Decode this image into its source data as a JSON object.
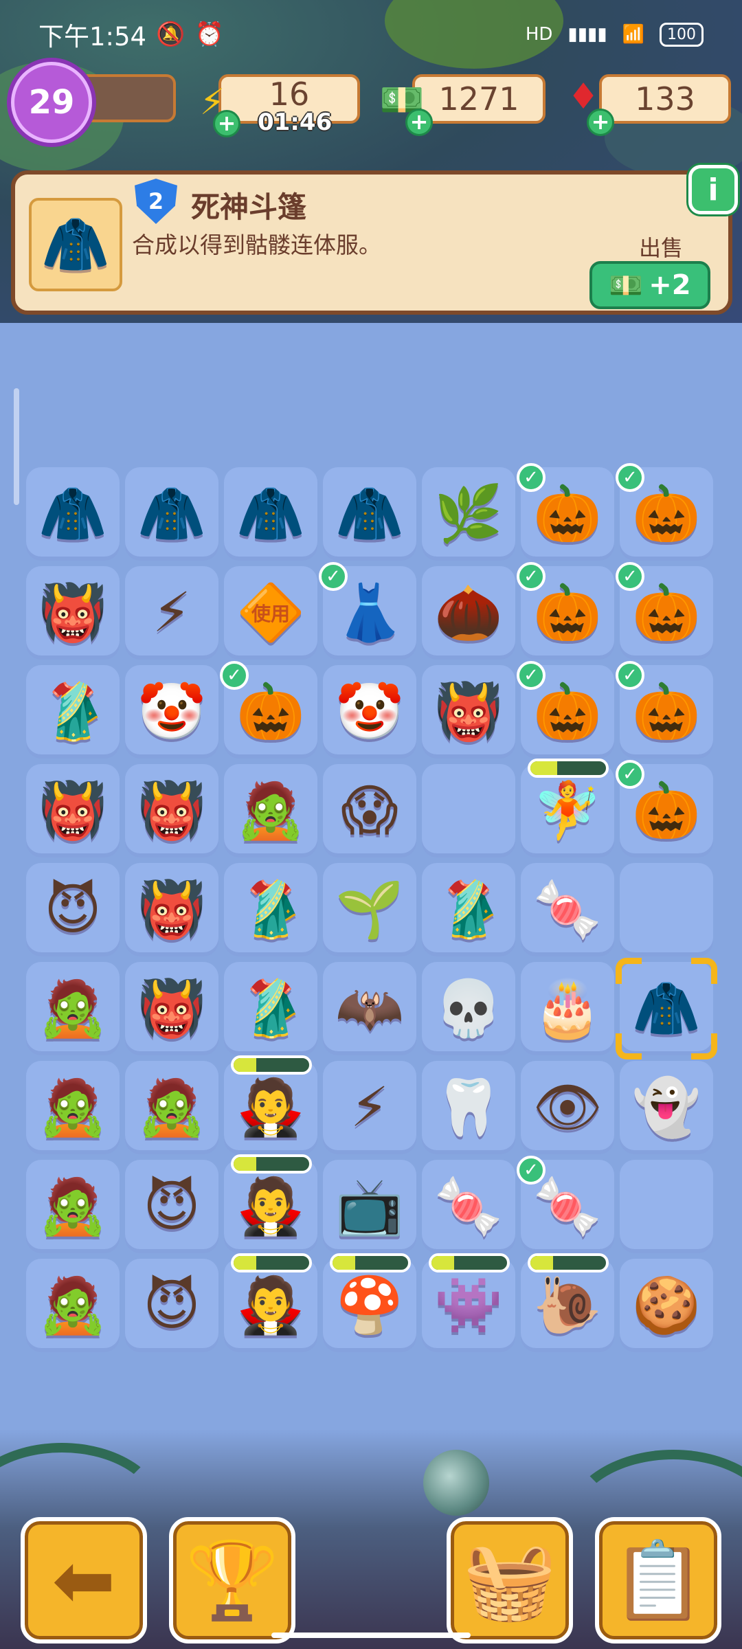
{
  "status_bar": {
    "time": "下午1:54",
    "icons": [
      "mute-icon",
      "alarm-icon"
    ],
    "network": "HD",
    "battery": "100"
  },
  "resources": {
    "level": "29",
    "energy": "16",
    "energy_timer": "01:46",
    "cash": "1271",
    "gems": "133"
  },
  "item_panel": {
    "tier": "2",
    "title": "死神斗篷",
    "description": "合成以得到骷髅连体服。",
    "sell_label": "出售",
    "sell_value": "+2",
    "info_label": "i"
  },
  "board": {
    "rows": [
      [
        {
          "item": "wizard-robe",
          "glyph": "🧥"
        },
        {
          "item": "wizard-robe",
          "glyph": "🧥"
        },
        {
          "item": "wizard-robe",
          "glyph": "🧥"
        },
        {
          "item": "wizard-robe",
          "glyph": "🧥"
        },
        {
          "item": "leafy-bush",
          "glyph": "🌿"
        },
        {
          "item": "pumpkin-generator",
          "glyph": "🎃",
          "check": true
        },
        {
          "item": "pumpkin-generator",
          "glyph": "🎃",
          "check": true
        }
      ],
      [
        {
          "item": "red-devil-costume",
          "glyph": "👹"
        },
        {
          "item": "energy-orb",
          "glyph": "⚡"
        },
        {
          "item": "locked-tile",
          "glyph": "🔶",
          "label": "使用"
        },
        {
          "item": "fancy-dress",
          "glyph": "👗",
          "check": true
        },
        {
          "item": "seeds",
          "glyph": "🌰"
        },
        {
          "item": "pumpkin-generator",
          "glyph": "🎃",
          "check": true
        },
        {
          "item": "pumpkin-generator",
          "glyph": "🎃",
          "check": true
        }
      ],
      [
        {
          "item": "green-fairy-dress",
          "glyph": "🥻"
        },
        {
          "item": "clown-costume",
          "glyph": "🤡"
        },
        {
          "item": "energy-pumpkin",
          "glyph": "🎃",
          "check": true
        },
        {
          "item": "clown-costume",
          "glyph": "🤡"
        },
        {
          "item": "red-devil-costume",
          "glyph": "👹"
        },
        {
          "item": "pumpkin-generator",
          "glyph": "🎃",
          "check": true
        },
        {
          "item": "pumpkin-generator",
          "glyph": "🎃",
          "check": true
        }
      ],
      [
        {
          "item": "red-devil-costume",
          "glyph": "👹"
        },
        {
          "item": "red-devil-costume",
          "glyph": "👹"
        },
        {
          "item": "zombie-head",
          "glyph": "🧟"
        },
        {
          "item": "nun-mask",
          "glyph": "😱"
        },
        {
          "item": "empty"
        },
        {
          "item": "fairy-girl",
          "glyph": "🧚",
          "progress": 0.35
        },
        {
          "item": "pumpkin-generator",
          "glyph": "🎃",
          "check": true
        }
      ],
      [
        {
          "item": "devil-mask",
          "glyph": "😈"
        },
        {
          "item": "red-devil-costume",
          "glyph": "👹"
        },
        {
          "item": "green-fairy-dress",
          "glyph": "🥻"
        },
        {
          "item": "sprout",
          "glyph": "🌱"
        },
        {
          "item": "green-fairy-dress",
          "glyph": "🥻"
        },
        {
          "item": "candy-plate",
          "glyph": "🍬"
        },
        {
          "item": "empty"
        }
      ],
      [
        {
          "item": "frankenstein-head",
          "glyph": "🧟"
        },
        {
          "item": "red-devil-costume",
          "glyph": "👹"
        },
        {
          "item": "green-fairy-dress",
          "glyph": "🥻"
        },
        {
          "item": "purple-bat",
          "glyph": "🦇"
        },
        {
          "item": "skull-lollipop",
          "glyph": "💀"
        },
        {
          "item": "ghost-cake",
          "glyph": "🎂"
        },
        {
          "item": "reaper-cloak",
          "glyph": "🧥",
          "selected": true
        }
      ],
      [
        {
          "item": "frankenstein-head",
          "glyph": "🧟"
        },
        {
          "item": "frankenstein-head",
          "glyph": "🧟"
        },
        {
          "item": "vampire-head",
          "glyph": "🧛",
          "progress": 0.3
        },
        {
          "item": "energy-cauldron",
          "glyph": "⚡"
        },
        {
          "item": "tooth",
          "glyph": "🦷"
        },
        {
          "item": "eyeball",
          "glyph": "👁"
        },
        {
          "item": "ghost",
          "glyph": "👻"
        }
      ],
      [
        {
          "item": "frankenstein-head",
          "glyph": "🧟"
        },
        {
          "item": "devil-mask",
          "glyph": "😈"
        },
        {
          "item": "vampire-head",
          "glyph": "🧛",
          "progress": 0.3
        },
        {
          "item": "retro-tv",
          "glyph": "📺"
        },
        {
          "item": "wrapped-candy",
          "glyph": "🍬"
        },
        {
          "item": "candy-plate",
          "glyph": "🍬",
          "check": true
        },
        {
          "item": "empty"
        }
      ],
      [
        {
          "item": "frankenstein-head",
          "glyph": "🧟"
        },
        {
          "item": "devil-mask",
          "glyph": "😈"
        },
        {
          "item": "vampire-head",
          "glyph": "🧛",
          "progress": 0.3
        },
        {
          "item": "mushroom-house",
          "glyph": "🍄",
          "progress": 0.3
        },
        {
          "item": "monster-gate",
          "glyph": "👾",
          "progress": 0.3
        },
        {
          "item": "snail-shell-house",
          "glyph": "🐌",
          "progress": 0.3
        },
        {
          "item": "jack-o-lantern-cookie",
          "glyph": "🍪"
        }
      ]
    ]
  },
  "bottom_nav": [
    {
      "name": "back-button",
      "icon": "arrow-left-icon",
      "glyph": "⬅"
    },
    {
      "name": "leaderboard-button",
      "icon": "podium-icon",
      "glyph": "🏆"
    },
    {
      "name": "shop-button",
      "icon": "basket-icon",
      "glyph": "🧺"
    },
    {
      "name": "tasks-button",
      "icon": "clipboard-star-icon",
      "glyph": "📋"
    }
  ]
}
